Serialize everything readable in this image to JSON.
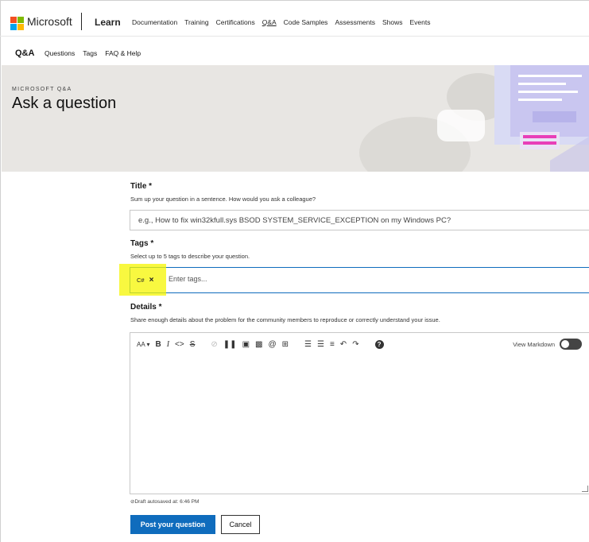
{
  "header": {
    "brand": "Microsoft",
    "product": "Learn",
    "nav": [
      "Documentation",
      "Training",
      "Certifications",
      "Q&A",
      "Code Samples",
      "Assessments",
      "Shows",
      "Events"
    ],
    "active_nav": "Q&A"
  },
  "subnav": {
    "title": "Q&A",
    "links": [
      "Questions",
      "Tags",
      "FAQ & Help"
    ]
  },
  "hero": {
    "label": "MICROSOFT Q&A",
    "title": "Ask a question"
  },
  "form": {
    "title_label": "Title *",
    "title_hint": "Sum up your question in a sentence. How would you ask a colleague?",
    "title_placeholder": "e.g., How to fix win32kfull.sys BSOD SYSTEM_SERVICE_EXCEPTION on my Windows PC?",
    "tags_label": "Tags *",
    "tags_hint": "Select up to 5 tags to describe your question.",
    "tags": [
      "C#"
    ],
    "tag_remove": "×",
    "tags_placeholder": "Enter tags...",
    "details_label": "Details *",
    "details_hint": "Share enough details about the problem for the community members to reproduce or correctly understand your issue.",
    "view_markdown": "View Markdown",
    "draft_status": "Draft autosaved at: 6:46 PM",
    "submit": "Post your question",
    "cancel": "Cancel"
  },
  "colors": {
    "accent": "#0f6cbd",
    "highlight": "#f5f500",
    "ms_red": "#f25022",
    "ms_green": "#7fba00",
    "ms_blue": "#00a4ef",
    "ms_yellow": "#ffb900"
  }
}
